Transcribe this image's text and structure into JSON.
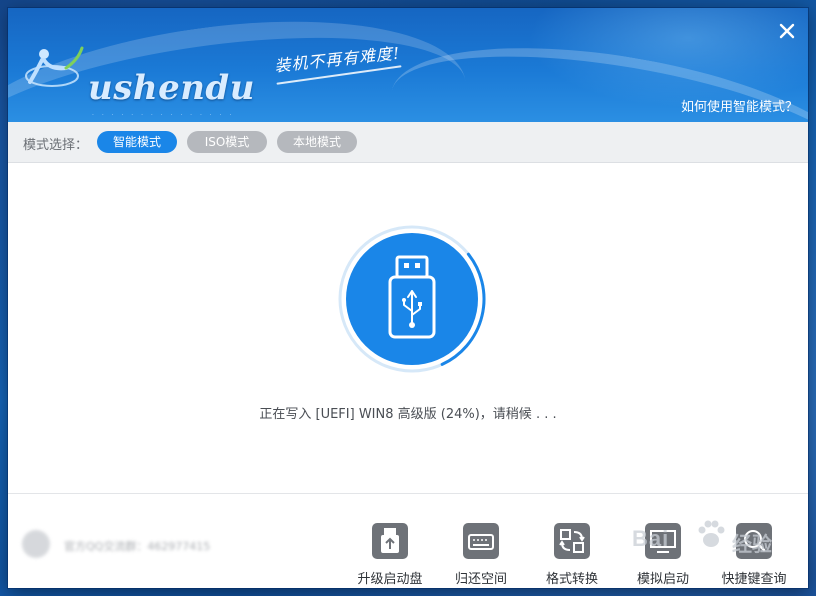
{
  "window": {
    "slogan": "装机不再有难度!",
    "help_link": "如何使用智能模式？",
    "close_icon": "close-icon"
  },
  "mode_bar": {
    "label": "模式选择：",
    "modes": [
      {
        "label": "智能模式",
        "active": true
      },
      {
        "label": "ISO模式",
        "active": false
      },
      {
        "label": "本地模式",
        "active": false
      }
    ]
  },
  "progress": {
    "status_text": "正在写入 [UEFI] WIN8 高级版 (24%)，请稍候 . . .",
    "percent": 24
  },
  "footer": {
    "qq_group": "官方QQ交流群：462977415",
    "tools": [
      {
        "label": "升级启动盘",
        "icon": "usb-upgrade-icon"
      },
      {
        "label": "归还空间",
        "icon": "disk-restore-icon"
      },
      {
        "label": "格式转换",
        "icon": "format-convert-icon"
      },
      {
        "label": "模拟启动",
        "icon": "simulate-boot-icon"
      },
      {
        "label": "快捷键查询",
        "icon": "hotkey-search-icon"
      }
    ]
  },
  "colors": {
    "accent": "#1a86e8",
    "header": "#1b7ad6",
    "pill_inactive": "#b5b8bd"
  }
}
